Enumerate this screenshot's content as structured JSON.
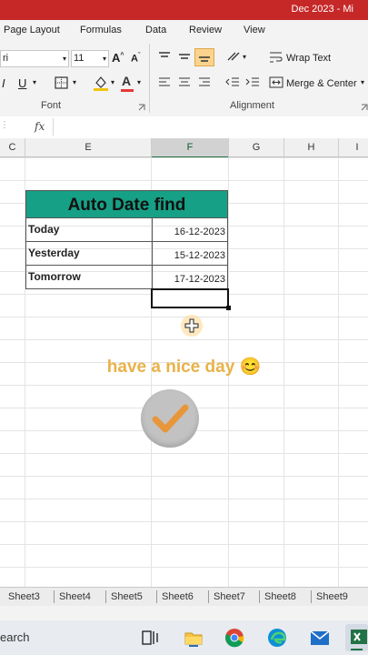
{
  "window": {
    "title": "Dec 2023 - Mi"
  },
  "menu": {
    "tabs": [
      "Page Layout",
      "Formulas",
      "Data",
      "Review",
      "View"
    ]
  },
  "ribbon": {
    "font_name": "ri",
    "font_size": "11",
    "font_group_label": "Font",
    "alignment_group_label": "Alignment",
    "wrap_text": "Wrap Text",
    "merge_center": "Merge & Center",
    "accent": "#217346"
  },
  "formula_bar": {
    "fx": "fx",
    "value": ""
  },
  "columns": {
    "c": "C",
    "e": "E",
    "f": "F",
    "g": "G",
    "h": "H",
    "i": "I"
  },
  "table": {
    "title": "Auto Date find",
    "header_color": "#16a085",
    "rows": [
      {
        "label": "Today",
        "value": "16-12-2023"
      },
      {
        "label": "Yesterday",
        "value": "15-12-2023"
      },
      {
        "label": "Tomorrow",
        "value": "17-12-2023"
      }
    ]
  },
  "overlay": {
    "message": "have a nice day 😊",
    "message_color": "#e9b24a"
  },
  "sheets": [
    "Sheet3",
    "Sheet4",
    "Sheet5",
    "Sheet6",
    "Sheet7",
    "Sheet8",
    "Sheet9"
  ],
  "taskbar": {
    "search_text": "earch"
  }
}
